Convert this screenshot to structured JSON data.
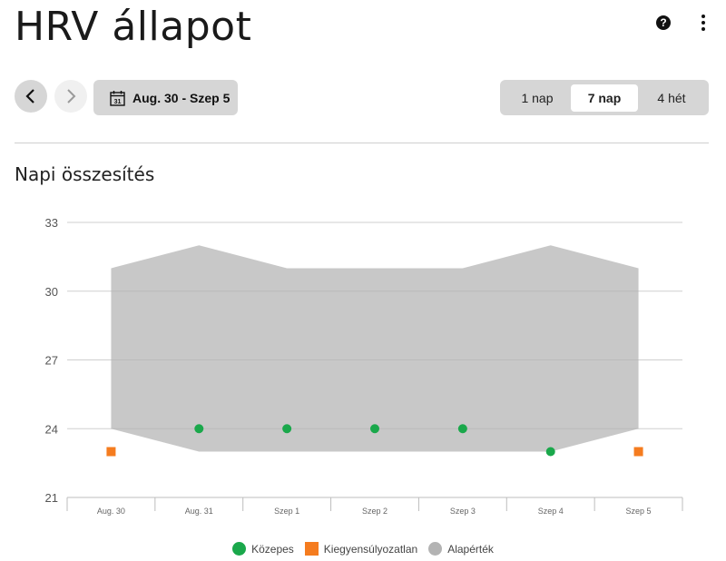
{
  "header": {
    "title": "HRV állapot",
    "help_icon": "help-icon",
    "more_icon": "more-vertical-icon"
  },
  "toolbar": {
    "date_range": "Aug. 30 - Szep 5",
    "calendar_icon_day": "31",
    "ranges": [
      {
        "label": "1 nap",
        "active": false
      },
      {
        "label": "7 nap",
        "active": true
      },
      {
        "label": "4 hét",
        "active": false
      }
    ]
  },
  "section": {
    "title": "Napi összesítés"
  },
  "colors": {
    "balanced": "#1aa84b",
    "unbalanced": "#f57c1f",
    "baseline": "#b3b3b3"
  },
  "chart_data": {
    "type": "scatter",
    "title": "",
    "xlabel": "",
    "ylabel": "",
    "categories": [
      "Aug. 30",
      "Aug. 31",
      "Szep 1",
      "Szep 2",
      "Szep 3",
      "Szep 4",
      "Szep 5"
    ],
    "ylim": [
      21,
      33
    ],
    "yticks": [
      21,
      24,
      27,
      30,
      33
    ],
    "grid": true,
    "legend_position": "bottom",
    "baseline": {
      "name": "Alapérték",
      "low": [
        24,
        23,
        23,
        23,
        23,
        23,
        24
      ],
      "high": [
        31,
        32,
        31,
        31,
        31,
        32,
        31
      ]
    },
    "points": [
      {
        "x": "Aug. 30",
        "y": 23,
        "status": "Kiegyensúlyozatlan"
      },
      {
        "x": "Aug. 31",
        "y": 24,
        "status": "Közepes"
      },
      {
        "x": "Szep 1",
        "y": 24,
        "status": "Közepes"
      },
      {
        "x": "Szep 2",
        "y": 24,
        "status": "Közepes"
      },
      {
        "x": "Szep 3",
        "y": 24,
        "status": "Közepes"
      },
      {
        "x": "Szep 4",
        "y": 23,
        "status": "Közepes"
      },
      {
        "x": "Szep 5",
        "y": 23,
        "status": "Kiegyensúlyozatlan"
      }
    ],
    "legend": [
      {
        "label": "Közepes",
        "shape": "circle",
        "color": "#1aa84b"
      },
      {
        "label": "Kiegyensúlyozatlan",
        "shape": "square",
        "color": "#f57c1f"
      },
      {
        "label": "Alapérték",
        "shape": "circle",
        "color": "#b3b3b3"
      }
    ]
  }
}
